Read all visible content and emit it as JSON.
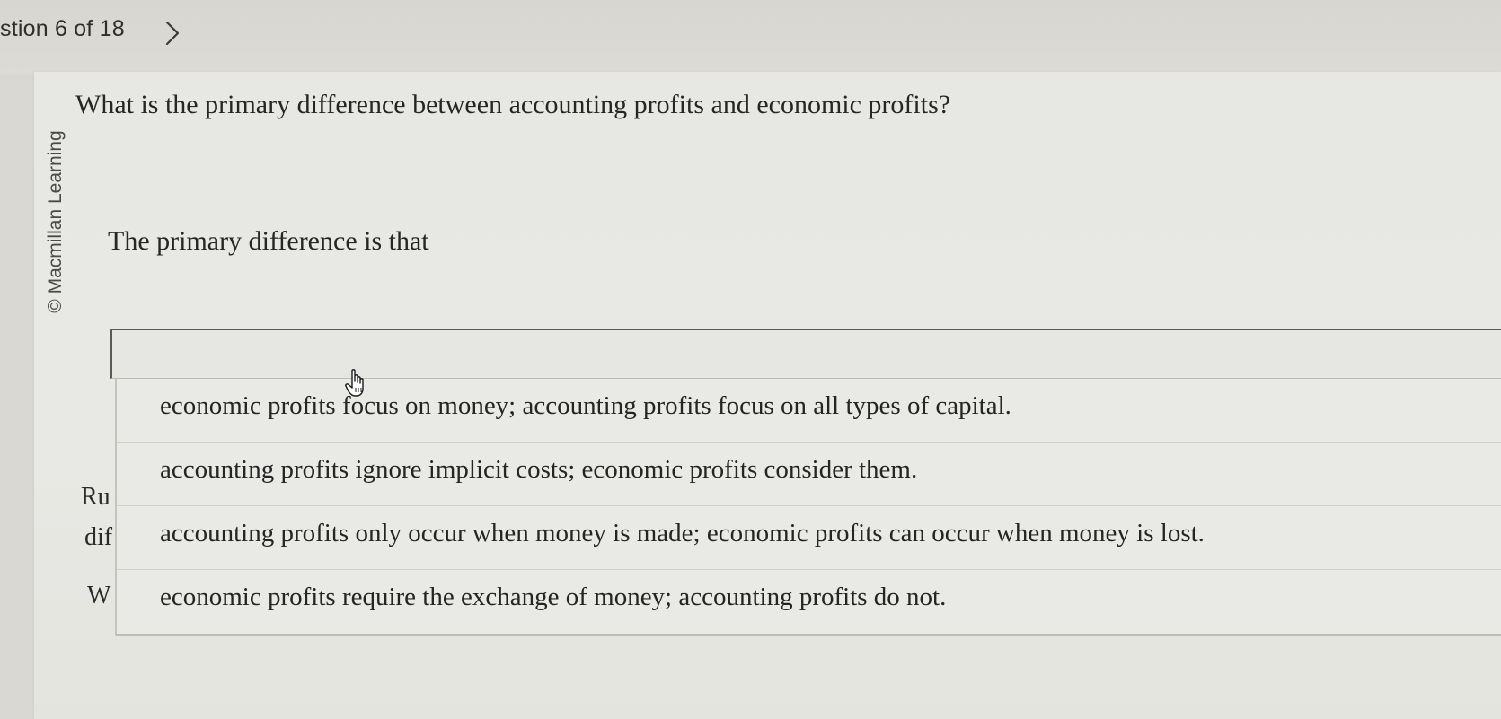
{
  "header": {
    "question_counter": "stion 6 of 18",
    "next_icon": "chevron-right-icon"
  },
  "credit": {
    "text": "© Macmillan Learning"
  },
  "question": {
    "text": "What is the primary difference between accounting profits and economic profits?"
  },
  "prompt": {
    "text": "The primary difference is that"
  },
  "dropdown": {
    "selected_value": "",
    "options": [
      "economic profits focus on money; accounting profits focus on all types of capital.",
      "accounting profits ignore implicit costs; economic profits consider them.",
      "accounting profits only occur when money is made; economic profits can occur when money is lost.",
      "economic profits require the exchange of money; accounting profits do not."
    ]
  },
  "obscured_text": {
    "line1": "Ru",
    "line2": "dif",
    "line3": "W"
  },
  "cursor": {
    "icon": "hand-pointer-icon"
  }
}
